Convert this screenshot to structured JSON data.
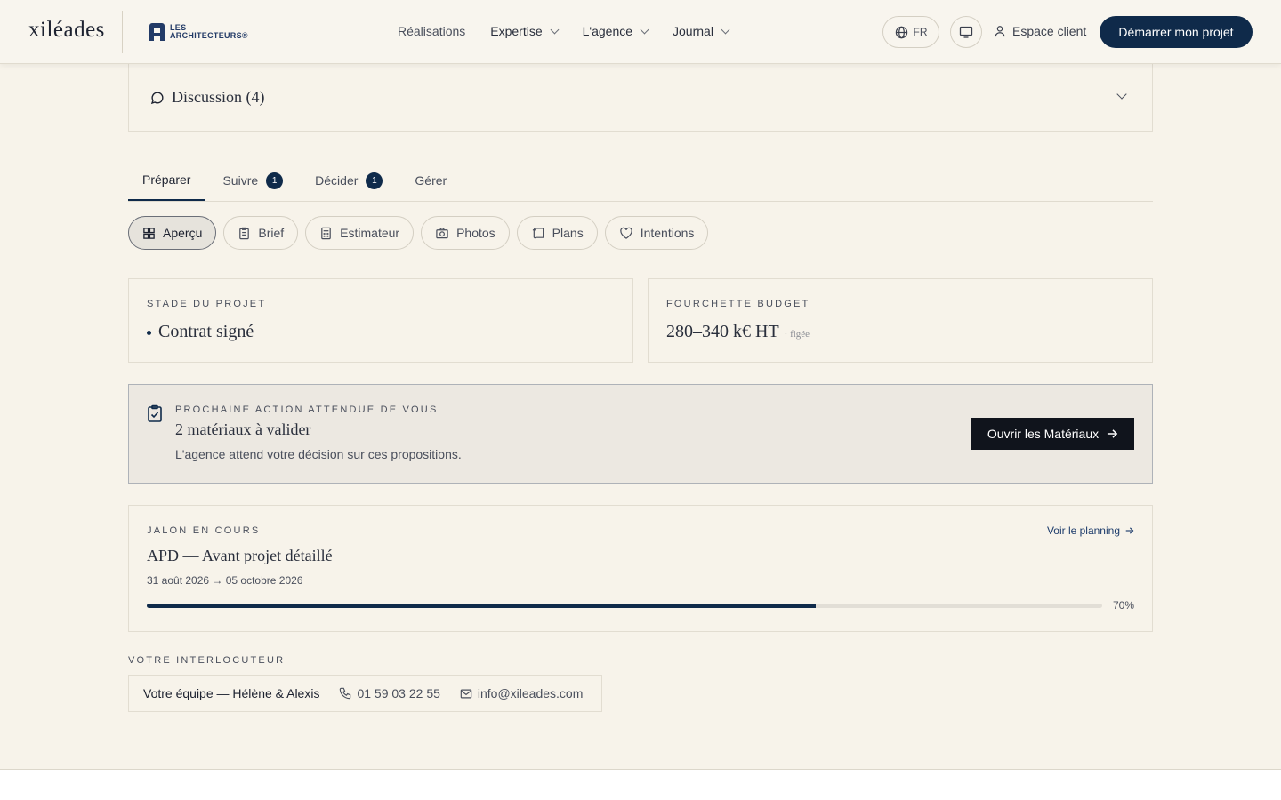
{
  "header": {
    "logo": "xiléades",
    "partner_line1": "LES",
    "partner_line2": "ARCHITECTEURS®",
    "nav": [
      {
        "label": "Réalisations"
      },
      {
        "label": "Expertise"
      },
      {
        "label": "L'agence"
      },
      {
        "label": "Journal"
      }
    ],
    "lang": "FR",
    "client_label": "Espace client",
    "cta_label": "Démarrer mon projet"
  },
  "discussion": {
    "label": "Discussion (4)"
  },
  "tabs": [
    {
      "label": "Préparer",
      "active": true
    },
    {
      "label": "Suivre",
      "badge": "1"
    },
    {
      "label": "Décider",
      "badge": "1"
    },
    {
      "label": "Gérer"
    }
  ],
  "pills": [
    {
      "label": "Aperçu",
      "icon": "grid-icon",
      "active": true
    },
    {
      "label": "Brief",
      "icon": "clipboard-icon"
    },
    {
      "label": "Estimateur",
      "icon": "calculator-icon"
    },
    {
      "label": "Photos",
      "icon": "camera-icon"
    },
    {
      "label": "Plans",
      "icon": "plans-icon"
    },
    {
      "label": "Intentions",
      "icon": "heart-icon"
    }
  ],
  "stage": {
    "eyebrow": "STADE DU PROJET",
    "value": "Contrat signé"
  },
  "budget": {
    "eyebrow": "FOURCHETTE BUDGET",
    "value": "280–340 k€ HT",
    "status": "· figée"
  },
  "action": {
    "eyebrow": "PROCHAINE ACTION ATTENDUE DE VOUS",
    "title": "2 matériaux à valider",
    "subtitle": "L'agence attend votre décision sur ces propositions.",
    "button": "Ouvrir les Matériaux"
  },
  "milestone": {
    "eyebrow": "JALON EN COURS",
    "title": "APD — Avant projet détaillé",
    "dates": "31 août 2026 → 05 octobre 2026",
    "link": "Voir le planning",
    "progress": 70,
    "progress_label": "70%"
  },
  "contact": {
    "eyebrow": "VOTRE INTERLOCUTEUR",
    "team": "Votre équipe — Hélène & Alexis",
    "phone": "01 59 03 22 55",
    "email": "info@xileades.com"
  },
  "colors": {
    "accent": "#0f2a4a",
    "background": "#f7f3ea"
  }
}
